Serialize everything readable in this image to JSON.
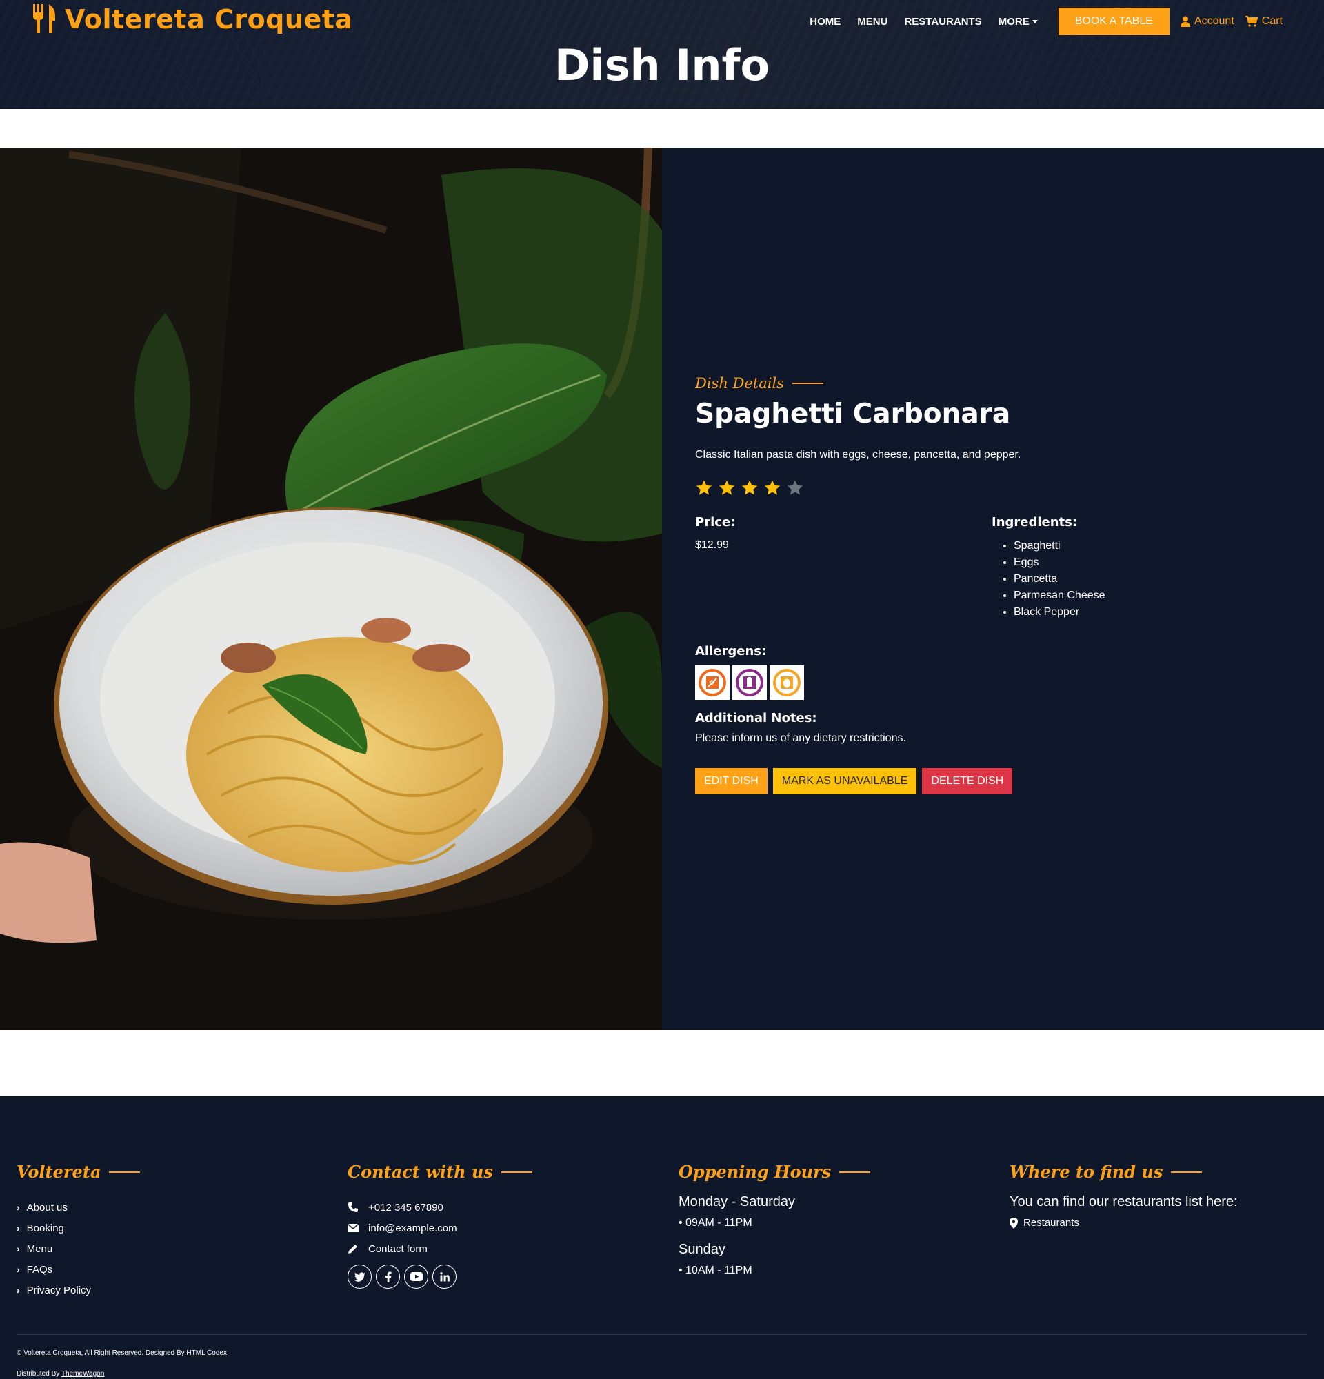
{
  "brand": {
    "name": "Voltereta Croqueta",
    "icon": "utensils-icon"
  },
  "nav": {
    "items": [
      "HOME",
      "MENU",
      "RESTAURANTS",
      "MORE"
    ],
    "book_label": "BOOK A TABLE",
    "account_label": "Account",
    "cart_label": "Cart"
  },
  "hero": {
    "title": "Dish Info"
  },
  "dish": {
    "kicker": "Dish Details",
    "name": "Spaghetti Carbonara",
    "description": "Classic Italian pasta dish with eggs, cheese, pancetta, and pepper.",
    "rating": 4,
    "rating_max": 5,
    "price_label": "Price:",
    "price": "$12.99",
    "ingredients_label": "Ingredients:",
    "ingredients": [
      "Spaghetti",
      "Eggs",
      "Pancetta",
      "Parmesan Cheese",
      "Black Pepper"
    ],
    "allergens_label": "Allergens:",
    "allergens": [
      {
        "icon": "gluten-icon",
        "color": "#f06a1b"
      },
      {
        "icon": "milk-icon",
        "color": "#8e2a8c"
      },
      {
        "icon": "egg-icon",
        "color": "#f5a623"
      }
    ],
    "notes_label": "Additional Notes:",
    "notes": "Please inform us of any dietary restrictions.",
    "actions": {
      "edit": "EDIT DISH",
      "unavailable": "MARK AS UNAVAILABLE",
      "delete": "DELETE DISH"
    }
  },
  "footer": {
    "col1": {
      "title": "Voltereta",
      "links": [
        "About us",
        "Booking",
        "Menu",
        "FAQs",
        "Privacy Policy"
      ]
    },
    "col2": {
      "title": "Contact with us",
      "phone": "+012 345 67890",
      "email": "info@example.com",
      "form": "Contact form",
      "socials": [
        "twitter-icon",
        "facebook-icon",
        "youtube-icon",
        "linkedin-icon"
      ]
    },
    "col3": {
      "title": "Oppening Hours",
      "day1": "Monday - Saturday",
      "time1": "• 09AM - 11PM",
      "day2": "Sunday",
      "time2": "• 10AM - 11PM"
    },
    "col4": {
      "title": "Where to find us",
      "text": "You can find our restaurants list here:",
      "link": "Restaurants"
    },
    "copyright": {
      "prefix": "©",
      "brand_link": "Voltereta Croqueta",
      "middle": ", All Right Reserved. Designed By",
      "designer_link": "HTML Codex",
      "distributed_prefix": "Distributed By",
      "distributor_link": "ThemeWagon"
    }
  },
  "colors": {
    "accent": "#fea116",
    "dark": "#0f172b",
    "danger": "#dc3545",
    "warning": "#ffc107"
  }
}
